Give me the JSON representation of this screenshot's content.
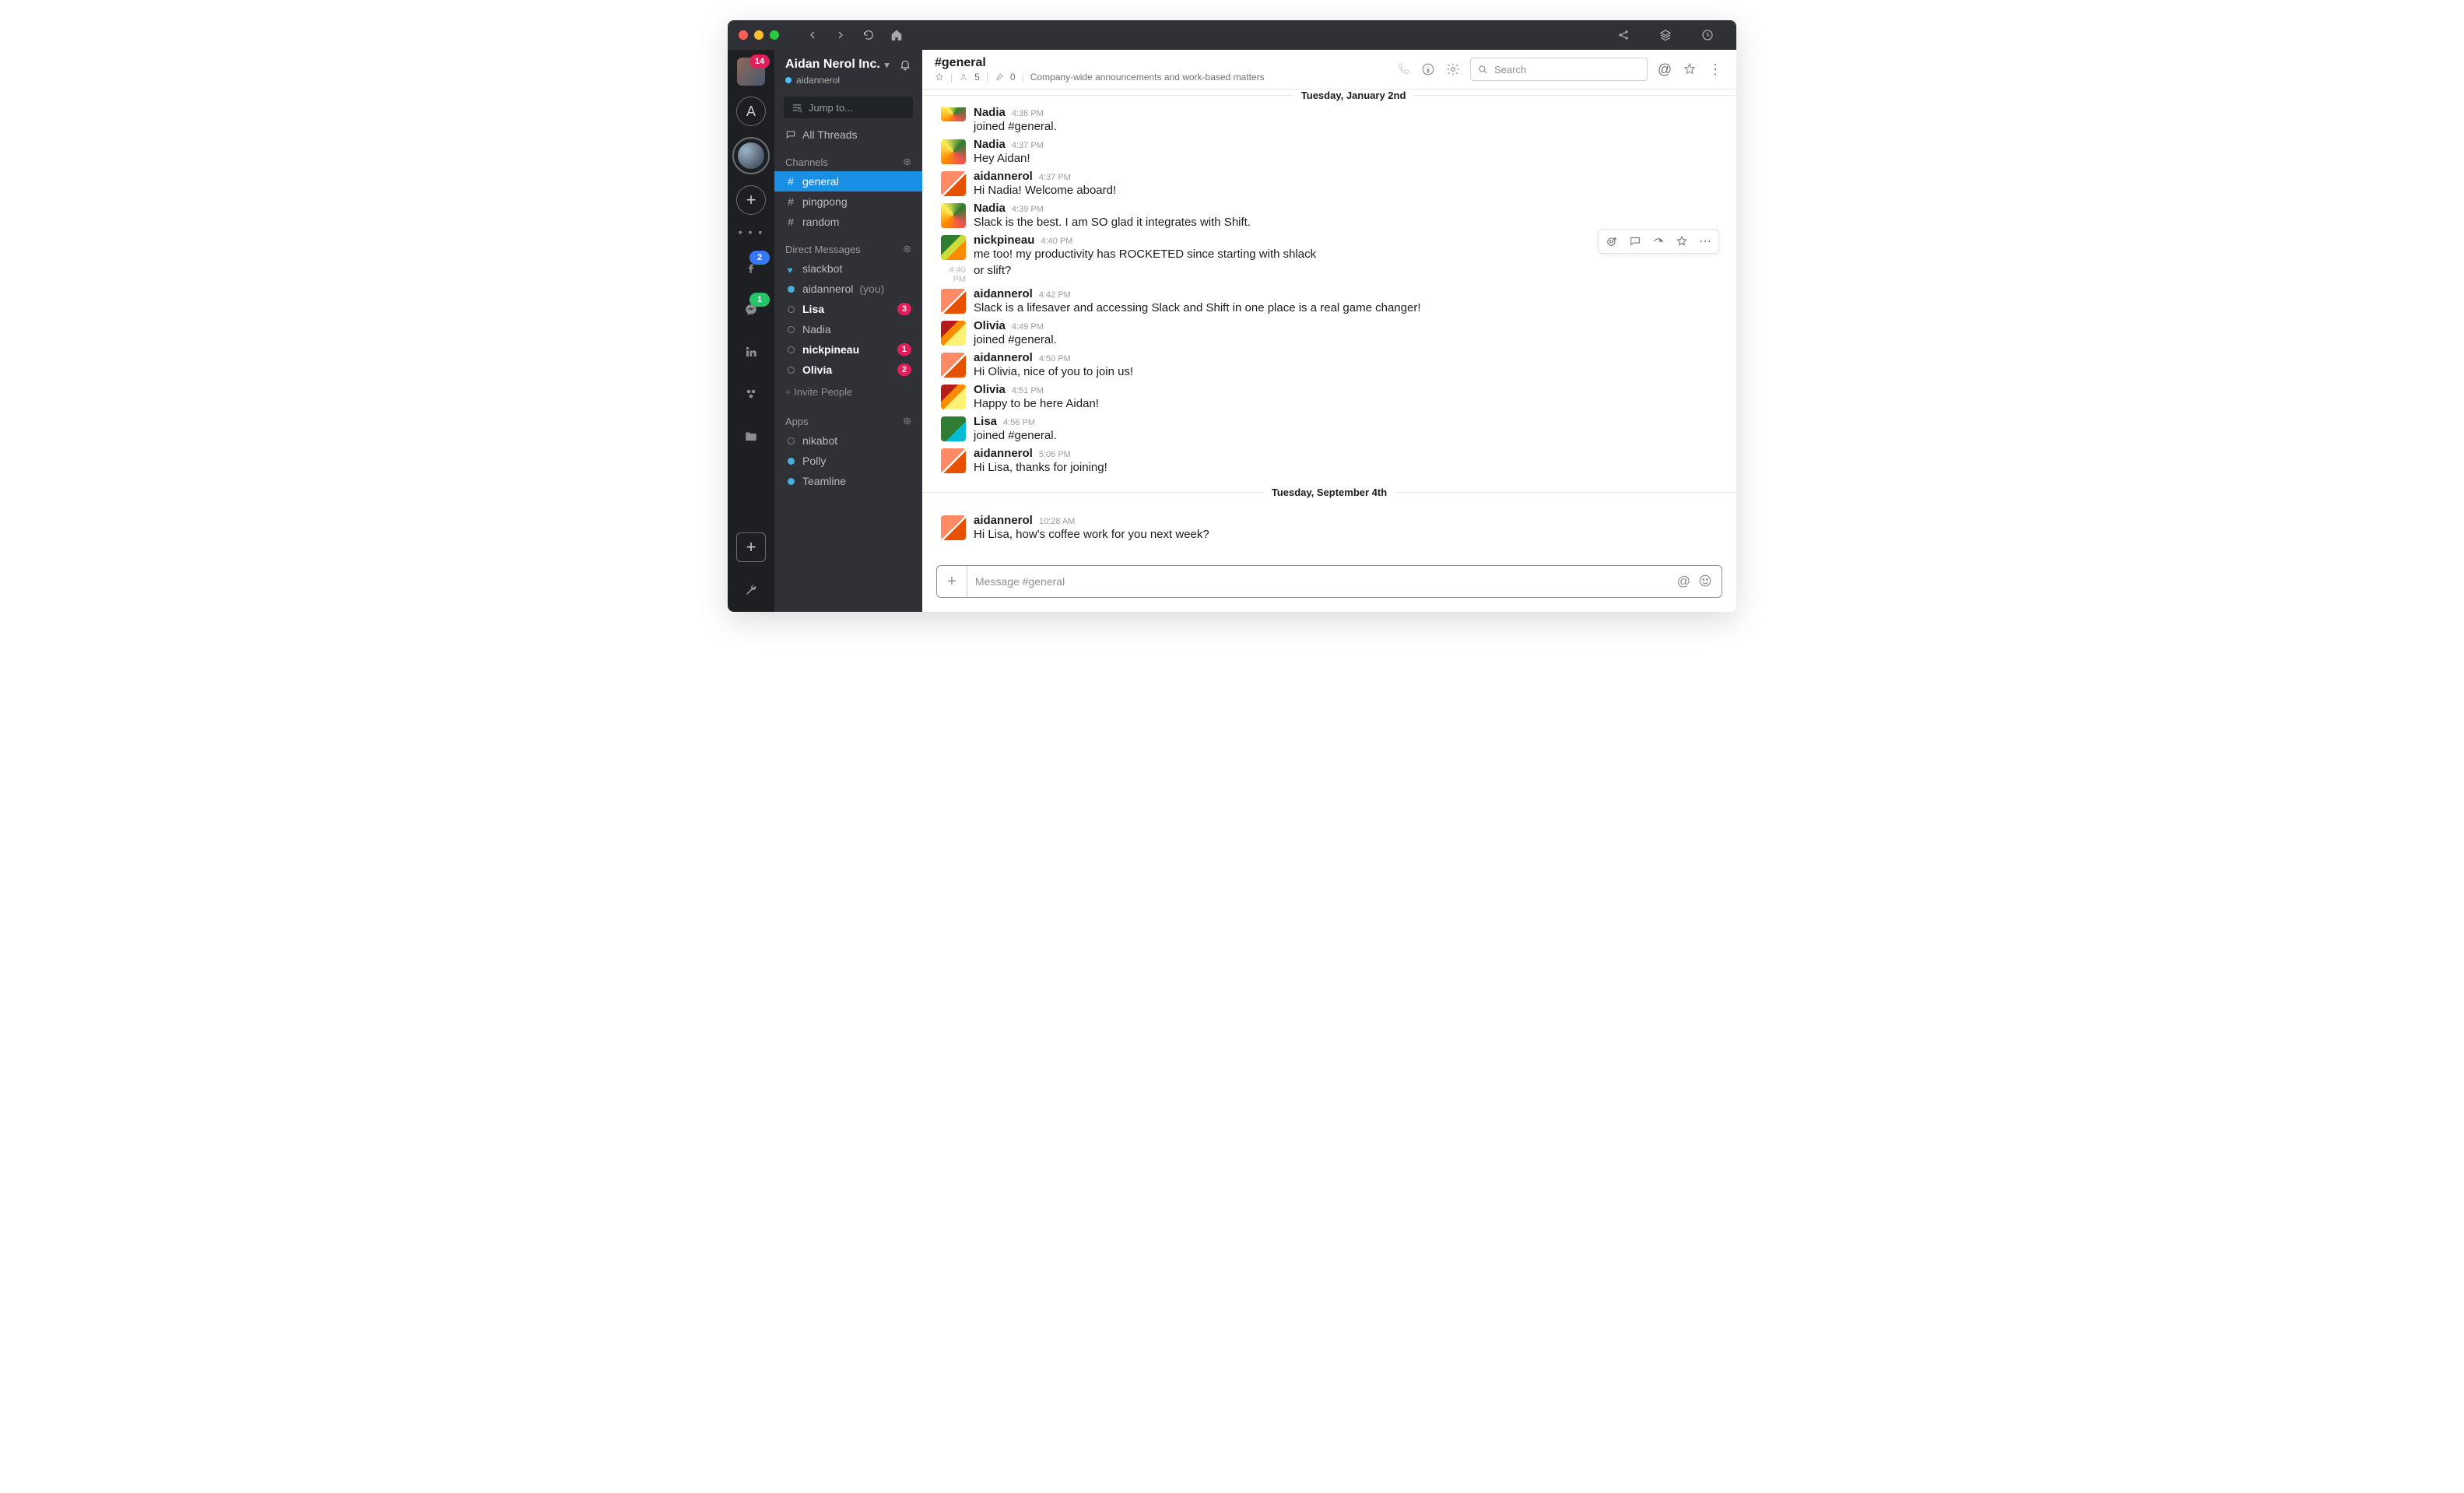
{
  "titlebar": {
    "traffic": [
      "red",
      "yellow",
      "green"
    ]
  },
  "rail": {
    "top_badge": "14",
    "letter": "A",
    "fb_badge": "2",
    "msgr_badge": "1"
  },
  "workspace": {
    "name": "Aidan Nerol Inc.",
    "user": "aidannerol",
    "jump_placeholder": "Jump to...",
    "all_threads": "All Threads"
  },
  "sidebar": {
    "channels_label": "Channels",
    "channels": [
      {
        "name": "general",
        "active": true
      },
      {
        "name": "pingpong",
        "active": false
      },
      {
        "name": "random",
        "active": false
      }
    ],
    "dms_label": "Direct Messages",
    "dms": [
      {
        "name": "slackbot",
        "presence": "heart",
        "bold": false,
        "badge": null,
        "you": false
      },
      {
        "name": "aidannerol",
        "presence": "on",
        "bold": false,
        "badge": null,
        "you": true
      },
      {
        "name": "Lisa",
        "presence": "off",
        "bold": true,
        "badge": "3",
        "you": false
      },
      {
        "name": "Nadia",
        "presence": "off",
        "bold": false,
        "badge": null,
        "you": false
      },
      {
        "name": "nickpineau",
        "presence": "off",
        "bold": true,
        "badge": "1",
        "you": false
      },
      {
        "name": "Olivia",
        "presence": "off",
        "bold": true,
        "badge": "2",
        "you": false
      }
    ],
    "you_suffix": "(you)",
    "invite": "Invite People",
    "apps_label": "Apps",
    "apps": [
      {
        "name": "nikabot",
        "presence": "off"
      },
      {
        "name": "Polly",
        "presence": "on"
      },
      {
        "name": "Teamline",
        "presence": "on"
      }
    ]
  },
  "channel_header": {
    "title": "#general",
    "members": "5",
    "pins": "0",
    "topic": "Company-wide announcements and work-based matters",
    "search_placeholder": "Search"
  },
  "dividers": {
    "d1": "Tuesday, January 2nd",
    "d2": "Tuesday, September 4th"
  },
  "messages": [
    {
      "id": "m0",
      "author": "Nadia",
      "avatar": "a-nadia",
      "time": "4:36 PM",
      "text": "joined #general.",
      "clipped": true
    },
    {
      "id": "m1",
      "author": "Nadia",
      "avatar": "a-nadia",
      "time": "4:37 PM",
      "text": "Hey Aidan!"
    },
    {
      "id": "m2",
      "author": "aidannerol",
      "avatar": "a-aidan",
      "time": "4:37 PM",
      "text": "Hi Nadia! Welcome aboard!"
    },
    {
      "id": "m3",
      "author": "Nadia",
      "avatar": "a-nadia",
      "time": "4:39 PM",
      "text": "Slack is the best. I am SO glad it integrates with Shift."
    },
    {
      "id": "m4",
      "author": "nickpineau",
      "avatar": "a-nick",
      "time": "4:40 PM",
      "text": "me too! my productivity has ROCKETED since starting with shlack"
    },
    {
      "id": "m4b",
      "continued": true,
      "gutter_time": "4:40 PM",
      "text": "or slift?"
    },
    {
      "id": "m5",
      "author": "aidannerol",
      "avatar": "a-aidan",
      "time": "4:42 PM",
      "text": "Slack is a lifesaver and accessing Slack and Shift in one place is a real game changer!"
    },
    {
      "id": "m6",
      "author": "Olivia",
      "avatar": "a-olivia",
      "time": "4:49 PM",
      "text": "joined #general."
    },
    {
      "id": "m7",
      "author": "aidannerol",
      "avatar": "a-aidan",
      "time": "4:50 PM",
      "text": "Hi Olivia, nice of you to join us!"
    },
    {
      "id": "m8",
      "author": "Olivia",
      "avatar": "a-olivia",
      "time": "4:51 PM",
      "text": "Happy to be here Aidan!"
    },
    {
      "id": "m9",
      "author": "Lisa",
      "avatar": "a-lisa",
      "time": "4:56 PM",
      "text": "joined #general."
    },
    {
      "id": "m10",
      "author": "aidannerol",
      "avatar": "a-aidan",
      "time": "5:06 PM",
      "text": "Hi Lisa, thanks for joining!"
    },
    {
      "id": "m11",
      "author": "aidannerol",
      "avatar": "a-aidan",
      "time": "10:28 AM",
      "text": "Hi Lisa, how's coffee work for you next week?"
    }
  ],
  "composer": {
    "placeholder": "Message #general"
  }
}
